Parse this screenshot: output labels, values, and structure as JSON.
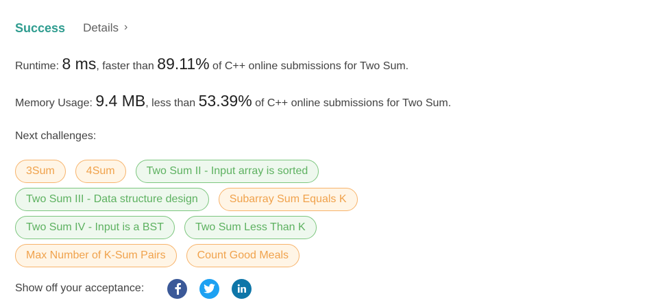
{
  "header": {
    "status": "Success",
    "details_label": "Details"
  },
  "runtime": {
    "label": "Runtime:",
    "value": "8 ms",
    "comparison": ", faster than",
    "percent": "89.11%",
    "suffix": "of C++ online submissions for Two Sum."
  },
  "memory": {
    "label": "Memory Usage:",
    "value": "9.4 MB",
    "comparison": ", less than",
    "percent": "53.39%",
    "suffix": "of C++ online submissions for Two Sum."
  },
  "next": {
    "label": "Next challenges:",
    "rows": [
      [
        {
          "label": "3Sum",
          "difficulty": "medium"
        },
        {
          "label": "4Sum",
          "difficulty": "medium"
        },
        {
          "label": "Two Sum II - Input array is sorted",
          "difficulty": "easy"
        }
      ],
      [
        {
          "label": "Two Sum III - Data structure design",
          "difficulty": "easy"
        },
        {
          "label": "Subarray Sum Equals K",
          "difficulty": "medium"
        }
      ],
      [
        {
          "label": "Two Sum IV - Input is a BST",
          "difficulty": "easy"
        },
        {
          "label": "Two Sum Less Than K",
          "difficulty": "easy"
        }
      ],
      [
        {
          "label": "Max Number of K-Sum Pairs",
          "difficulty": "medium"
        },
        {
          "label": "Count Good Meals",
          "difficulty": "medium"
        }
      ]
    ]
  },
  "share": {
    "label": "Show off your acceptance:",
    "icons": [
      {
        "name": "facebook-icon",
        "glyph": "f",
        "color": "#3b5998"
      },
      {
        "name": "twitter-icon",
        "glyph": "",
        "color": "#1da1f2"
      },
      {
        "name": "linkedin-icon",
        "glyph": "in",
        "color": "#0e76a8"
      }
    ]
  },
  "colors": {
    "success": "#2e9c8f",
    "medium_text": "#f0a24c",
    "easy_text": "#5db160"
  }
}
